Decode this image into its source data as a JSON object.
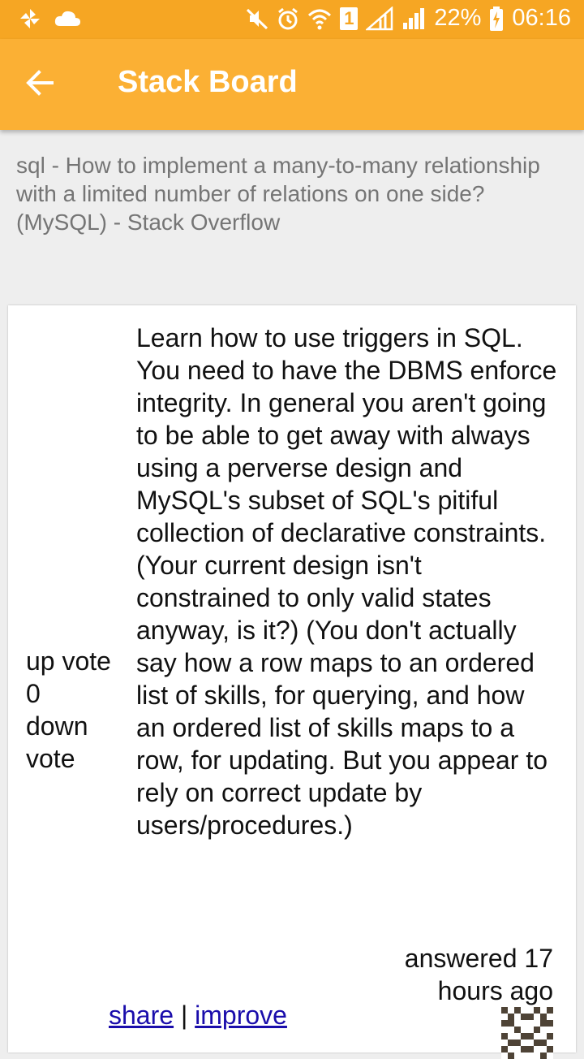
{
  "statusbar": {
    "battery": "22%",
    "time": "06:16",
    "sim": "1"
  },
  "appbar": {
    "title": "Stack Board"
  },
  "page": {
    "title": "sql - How to implement a many-to-many relationship with a limited number of relations on one side? (MySQL) - Stack Overflow"
  },
  "answer": {
    "vote_up": "up vote",
    "score": "0",
    "vote_down": "down vote",
    "body": "Learn how to use triggers in SQL. You need to have the DBMS enforce integrity. In general you aren't going to be able to get away with always using a perverse design and MySQL's subset of SQL's pitiful collection of declarative constraints. (Your current design isn't constrained to only valid states anyway, is it?) (You don't actually say how a row maps to an ordered list of skills, for querying, and how an ordered list of skills maps to a row, for updating. But you appear to rely on correct update by users/procedures.)",
    "answered": "answered 17 hours ago",
    "share_label": "share",
    "separator": "|",
    "improve_label": "improve"
  },
  "colors": {
    "statusbar": "#f6a623",
    "appbar": "#fbb034",
    "link": "#1a0dab"
  },
  "icons": [
    "pinwheel-icon",
    "cloud-icon",
    "mute-icon",
    "alarm-icon",
    "wifi-icon",
    "sim-icon",
    "signal-icon",
    "signal-2-icon",
    "battery-charging-icon",
    "back-arrow-icon",
    "avatar-identicon"
  ]
}
